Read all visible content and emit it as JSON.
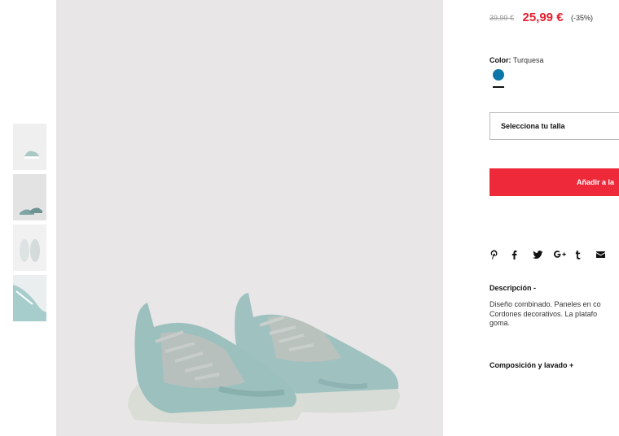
{
  "price": {
    "old": "39,99 €",
    "current": "25,99 €",
    "discount": "(-35%)"
  },
  "color": {
    "label": "Color:",
    "value": "Turquesa",
    "swatch_hex": "#0b76a8"
  },
  "size_select": {
    "label": "Selecciona tu talla"
  },
  "add_button": {
    "label": "Añadir a la"
  },
  "share_icons": [
    "pinterest-icon",
    "facebook-icon",
    "twitter-icon",
    "google-plus-icon",
    "tumblr-icon",
    "email-icon"
  ],
  "description": {
    "title": "Descripción -",
    "line1": "Diseño combinado. Paneles en co",
    "line2": "Cordones decorativos. La platafo",
    "line3": "goma."
  },
  "composition": {
    "title": "Composición y lavado +"
  },
  "colors": {
    "accent": "#ee2a3a",
    "price_red": "#e51f2f",
    "image_bg": "#e8e6e6"
  }
}
